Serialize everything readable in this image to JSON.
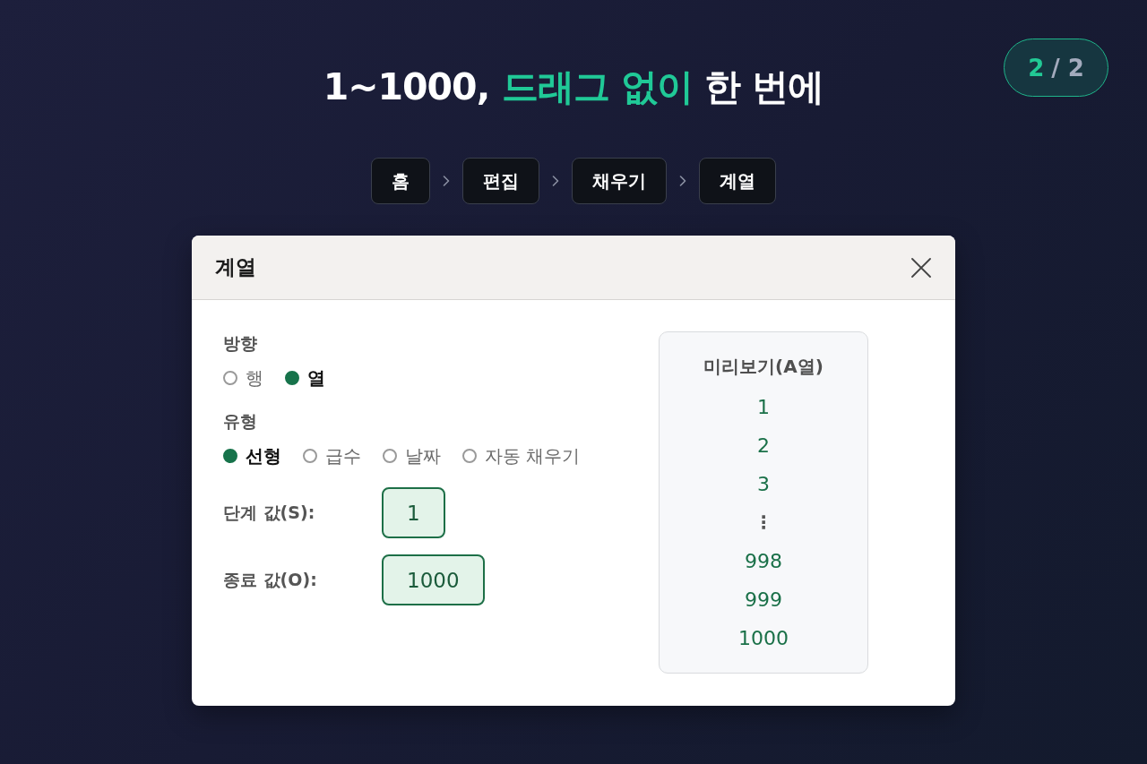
{
  "title": {
    "segments": [
      {
        "text": "1~1000, ",
        "highlight": false
      },
      {
        "text": "드래그 없이",
        "highlight": true
      },
      {
        "text": " 한 번에",
        "highlight": false
      }
    ]
  },
  "page_indicator": {
    "current": "2",
    "separator": "/",
    "total": "2"
  },
  "breadcrumb": [
    "홈",
    "편집",
    "채우기",
    "계열"
  ],
  "dialog": {
    "title": "계열",
    "groups": [
      {
        "label": "방향",
        "options": [
          {
            "label": "행",
            "selected": false
          },
          {
            "label": "열",
            "selected": true
          }
        ]
      },
      {
        "label": "유형",
        "options": [
          {
            "label": "선형",
            "selected": true
          },
          {
            "label": "급수",
            "selected": false
          },
          {
            "label": "날짜",
            "selected": false
          },
          {
            "label": "자동 채우기",
            "selected": false
          }
        ]
      }
    ],
    "fields": [
      {
        "label": "단계 값(S):",
        "value": "1"
      },
      {
        "label": "종료 값(O):",
        "value": "1000"
      }
    ],
    "preview": {
      "title": "미리보기(A열)",
      "rows": [
        {
          "kind": "value",
          "text": "1"
        },
        {
          "kind": "value",
          "text": "2"
        },
        {
          "kind": "value",
          "text": "3"
        },
        {
          "kind": "gap",
          "text": "⋮"
        },
        {
          "kind": "value",
          "text": "998"
        },
        {
          "kind": "value",
          "text": "999"
        },
        {
          "kind": "value",
          "text": "1000"
        }
      ]
    }
  }
}
